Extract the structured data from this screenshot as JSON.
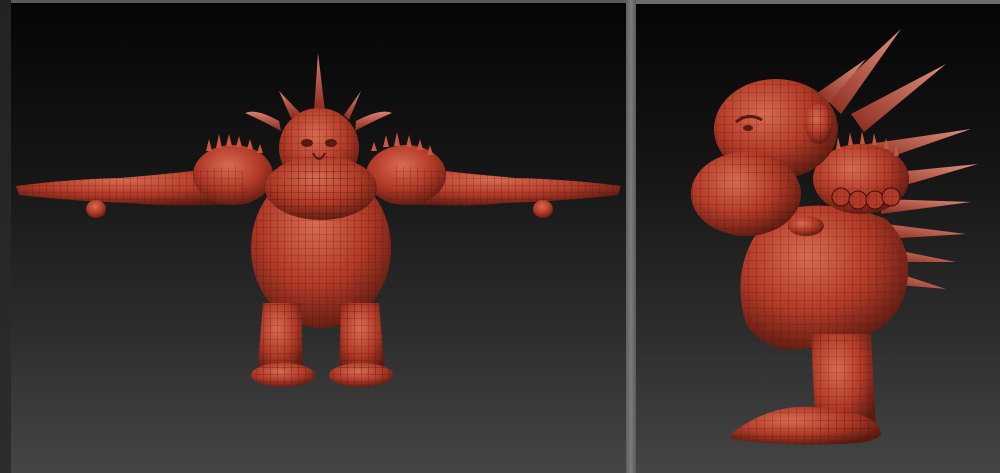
{
  "app": {
    "viewports": [
      {
        "id": "front",
        "view": "front"
      },
      {
        "id": "side",
        "view": "side"
      }
    ]
  },
  "model": {
    "material_color": "#b23a28",
    "highlight_color": "#d96b52",
    "shadow_color": "#5a1a10",
    "wire_color": "#3a0e08",
    "spike_color": "#c9573f"
  },
  "icons": {
    "front_figure": "troll-front-figure",
    "side_figure": "troll-side-figure"
  }
}
